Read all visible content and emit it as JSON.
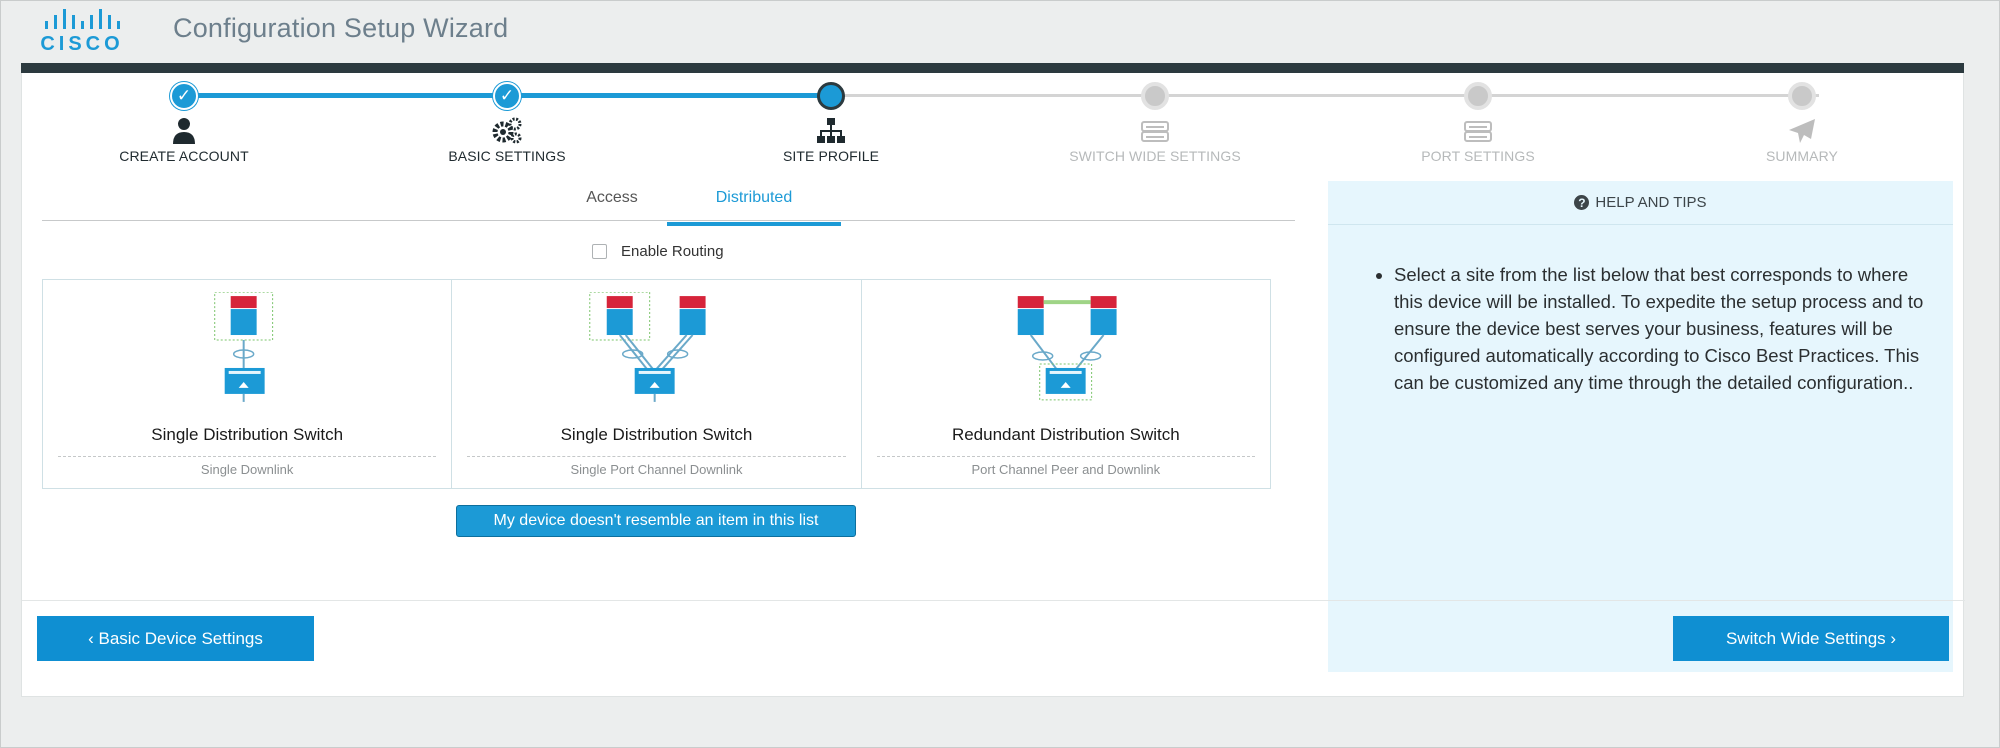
{
  "app": {
    "title": "Configuration Setup Wizard",
    "logo_text": "CISCO"
  },
  "stepper": {
    "steps": [
      {
        "label": "CREATE ACCOUNT",
        "state": "done",
        "icon": "user-icon"
      },
      {
        "label": "BASIC SETTINGS",
        "state": "done",
        "icon": "gears-icon"
      },
      {
        "label": "SITE PROFILE",
        "state": "active",
        "icon": "sitemap-icon"
      },
      {
        "label": "SWITCH WIDE SETTINGS",
        "state": "pending",
        "icon": "switch-icon"
      },
      {
        "label": "PORT SETTINGS",
        "state": "pending",
        "icon": "switch-icon"
      },
      {
        "label": "SUMMARY",
        "state": "pending",
        "icon": "paper-plane-icon"
      }
    ],
    "check_glyph": "✓"
  },
  "tabs": [
    {
      "label": "Access",
      "active": false
    },
    {
      "label": "Distributed",
      "active": true
    }
  ],
  "routing": {
    "label": "Enable Routing",
    "checked": false
  },
  "options": [
    {
      "title": "Single Distribution Switch",
      "subtitle": "Single Downlink"
    },
    {
      "title": "Single Distribution Switch",
      "subtitle": "Single Port Channel Downlink"
    },
    {
      "title": "Redundant Distribution Switch",
      "subtitle": "Port Channel Peer and Downlink"
    }
  ],
  "resemble_button": "My device doesn't resemble an item in this list",
  "help": {
    "title": "HELP AND TIPS",
    "icon_glyph": "?",
    "text": "Select a site from the list below that best corresponds to where this device will be installed. To expedite the setup process and to ensure the device best serves your business, features will be configured automatically according to Cisco Best Practices. This can be customized any time through the detailed configuration.."
  },
  "footer": {
    "prev_label": "‹ Basic Device Settings",
    "next_label": "Switch Wide Settings ›"
  },
  "colors": {
    "accent": "#1c9ad6",
    "header_bar": "#2c3a3f",
    "help_bg": "#e6f6fd",
    "router_red": "#d6243a"
  }
}
